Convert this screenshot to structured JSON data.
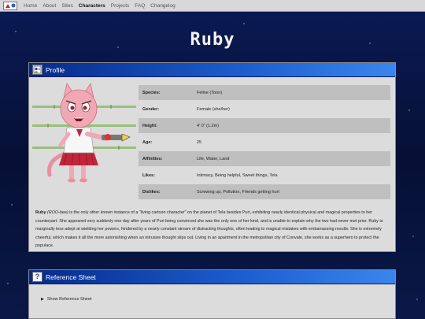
{
  "nav": {
    "links": [
      "Home",
      "About",
      "Sites",
      "Characters",
      "Projects",
      "FAQ",
      "Changelog"
    ],
    "active_index": 3
  },
  "page_title": "Ruby",
  "profile": {
    "title": "Profile",
    "stats": [
      {
        "key": "Species:",
        "value": "Feline (Toon)"
      },
      {
        "key": "Gender:",
        "value": "Female (she/her)"
      },
      {
        "key": "Height:",
        "value": "4' 0\" (1.2m)"
      },
      {
        "key": "Age:",
        "value": "25"
      },
      {
        "key": "Affinities:",
        "value": "Life, Water, Land"
      },
      {
        "key": "Likes:",
        "value": "Intimacy, Being helpful, Sweet things, Tela"
      },
      {
        "key": "Dislikes:",
        "value": "Screwing up, Pollution, Friends getting hurt"
      }
    ],
    "bio": {
      "name": "Ruby",
      "pronunciation": "(ROO-bee)",
      "text": " is the only other known instance of a \"living cartoon character\" on the planet of Tela besides Puri, exhibiting nearly identical physical and magical properties to her counterpart. She appeared very suddenly one day after years of Puri being convinced she was the only one of her kind, and is unable to explain why the two had never met prior. Ruby is marginally less adept at wielding her powers, hindered by a nearly constant stream of distracting thoughts, often leading to magical mistakes with embarrassing results. She is extremely cheerful, which makes it all the more astonishing when an intrusive thought slips out. Living in an apartment in the metropolitan city of Convale, she works as a superhero to protect the populace."
    }
  },
  "reference": {
    "title": "Reference Sheet",
    "toggle_label": "Show Reference Sheet"
  },
  "colors": {
    "titlebar_start": "#062a8a",
    "titlebar_end": "#3a86ec",
    "panel": "#dcdcdc",
    "row_shade": "#bfbfbf",
    "character_pink": "#f2a8b4",
    "skirt": "#c2253a"
  }
}
